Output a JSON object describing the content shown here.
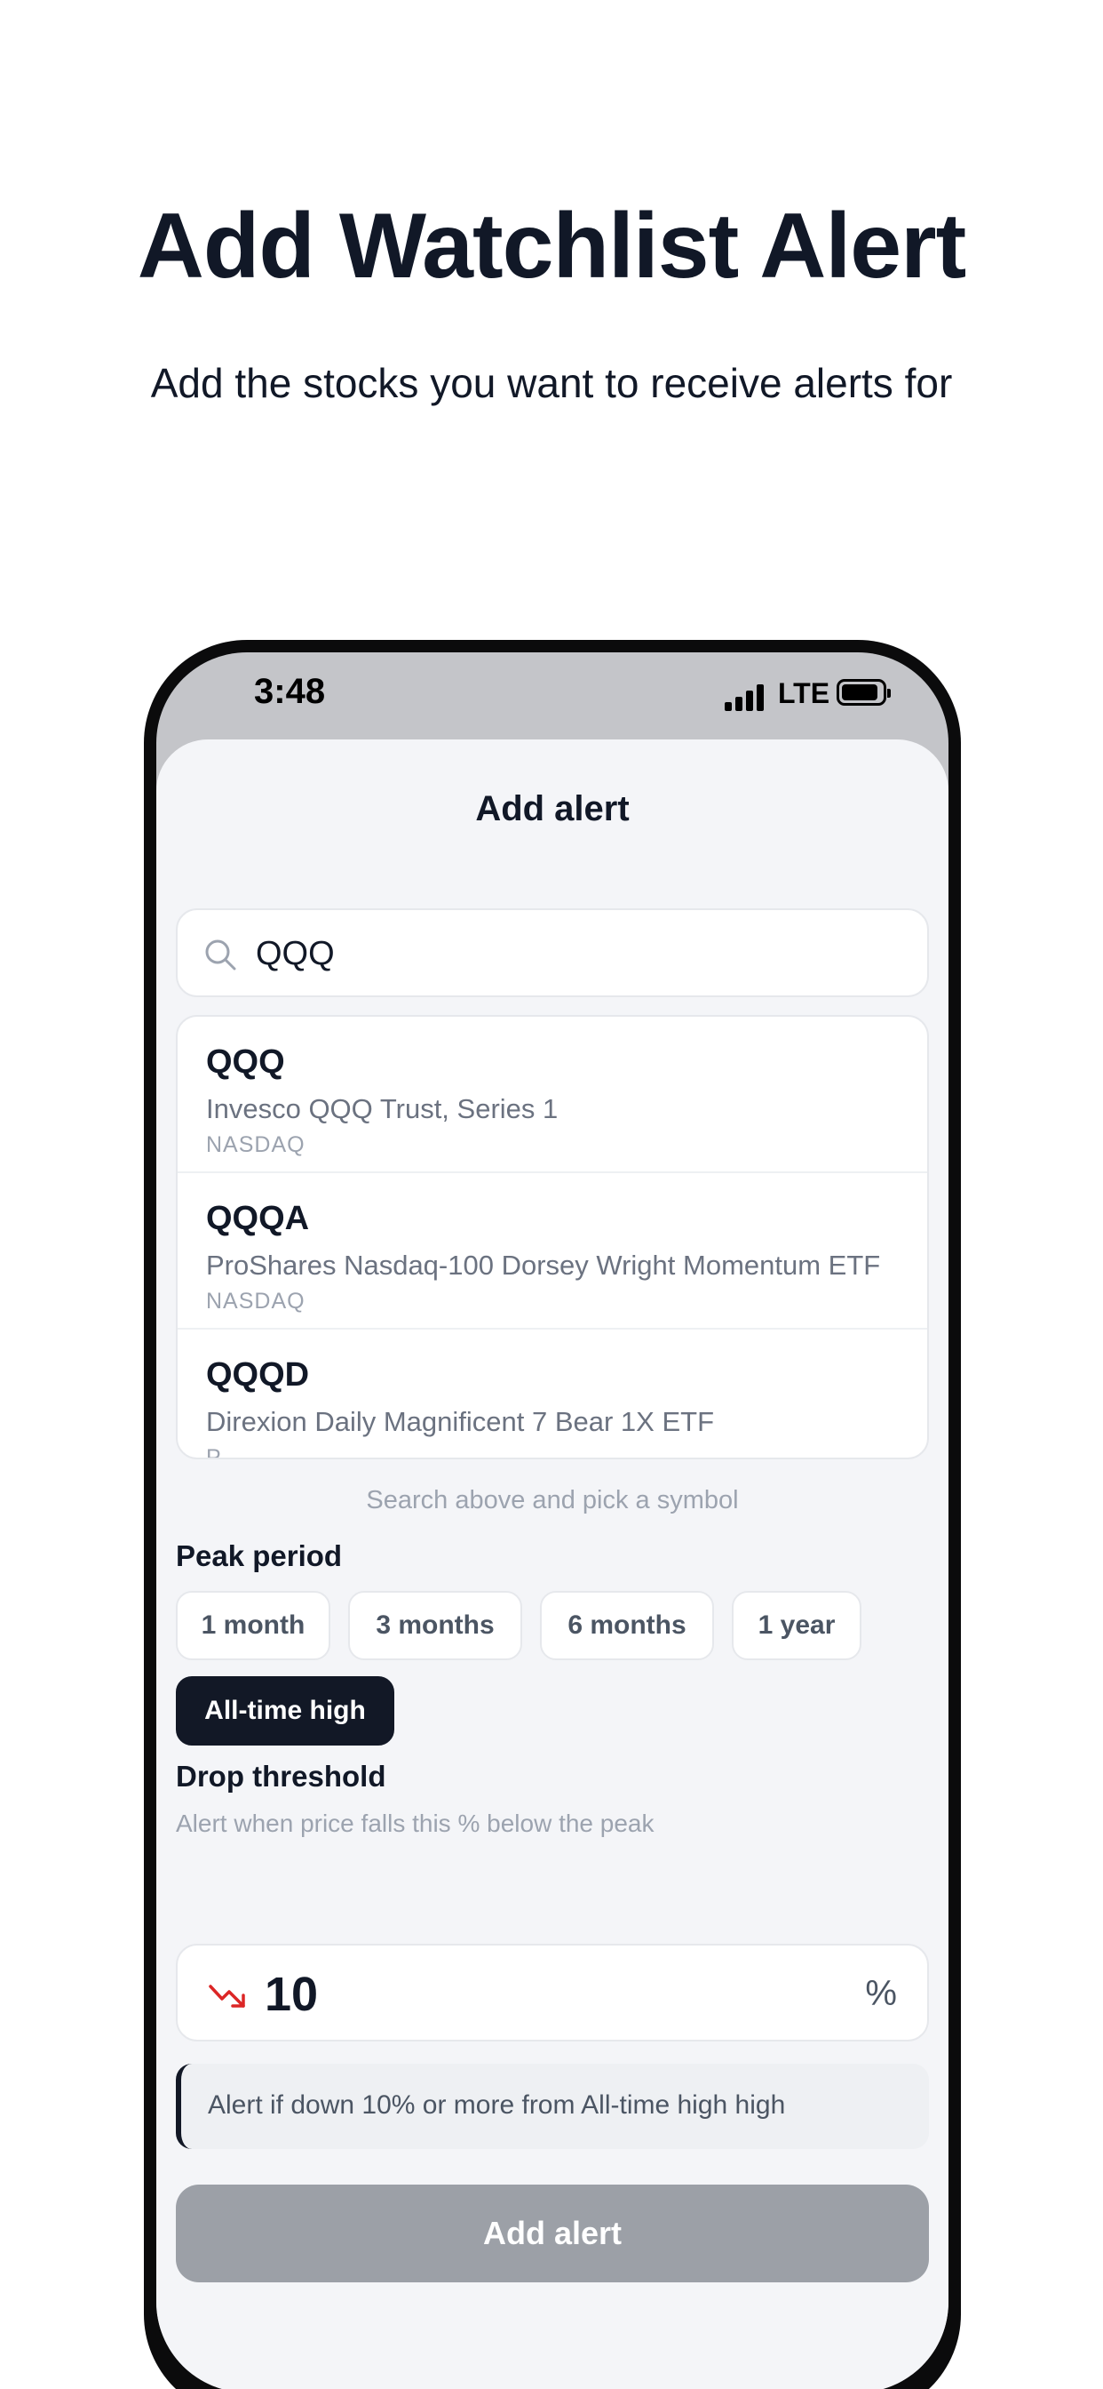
{
  "promo": {
    "title": "Add Watchlist Alert",
    "subtitle": "Add the stocks you want to receive alerts for"
  },
  "status_bar": {
    "time": "3:48",
    "network": "LTE"
  },
  "sheet": {
    "title": "Add alert"
  },
  "search": {
    "value": "QQQ",
    "icon": "search-icon"
  },
  "results": [
    {
      "symbol": "QQQ",
      "name": "Invesco QQQ Trust, Series 1",
      "exchange": "NASDAQ"
    },
    {
      "symbol": "QQQA",
      "name": "ProShares Nasdaq-100 Dorsey Wright Momentum ETF",
      "exchange": "NASDAQ"
    },
    {
      "symbol": "QQQD",
      "name": "Direxion Daily Magnificent 7 Bear 1X ETF",
      "exchange": "P"
    }
  ],
  "hint": "Search above and pick a symbol",
  "peak_period": {
    "label": "Peak period",
    "options": [
      "1 month",
      "3 months",
      "6 months",
      "1 year",
      "All-time high"
    ],
    "selected": "All-time high"
  },
  "drop_threshold": {
    "label": "Drop threshold",
    "description": "Alert when price falls this % below the peak",
    "value": "10",
    "unit": "%",
    "icon": "trending-down-icon"
  },
  "summary": "Alert if down 10% or more from All-time high high",
  "submit_label": "Add alert",
  "colors": {
    "accent_dark": "#121826",
    "trend_down": "#dc2626",
    "disabled_button": "#9ca0a7"
  }
}
